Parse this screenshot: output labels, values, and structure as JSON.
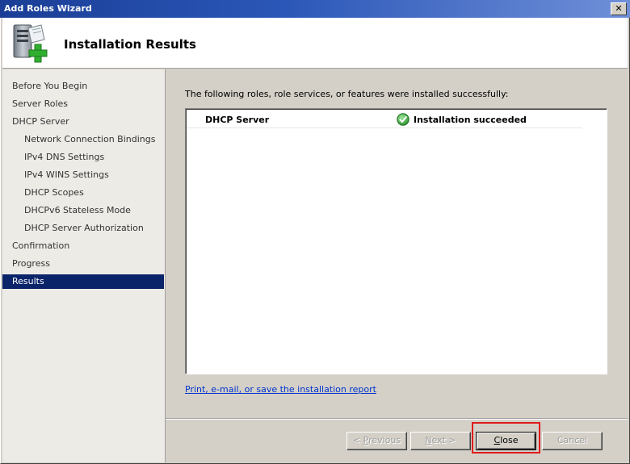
{
  "window": {
    "title": "Add Roles Wizard",
    "close_glyph": "✕"
  },
  "header": {
    "icon": "server-add-role-icon",
    "title": "Installation Results"
  },
  "sidebar": {
    "items": [
      {
        "label": "Before You Begin",
        "indent": false,
        "selected": false
      },
      {
        "label": "Server Roles",
        "indent": false,
        "selected": false
      },
      {
        "label": "DHCP Server",
        "indent": false,
        "selected": false
      },
      {
        "label": "Network Connection Bindings",
        "indent": true,
        "selected": false
      },
      {
        "label": "IPv4 DNS Settings",
        "indent": true,
        "selected": false
      },
      {
        "label": "IPv4 WINS Settings",
        "indent": true,
        "selected": false
      },
      {
        "label": "DHCP Scopes",
        "indent": true,
        "selected": false
      },
      {
        "label": "DHCPv6 Stateless Mode",
        "indent": true,
        "selected": false
      },
      {
        "label": "DHCP Server Authorization",
        "indent": true,
        "selected": false
      },
      {
        "label": "Confirmation",
        "indent": false,
        "selected": false
      },
      {
        "label": "Progress",
        "indent": false,
        "selected": false
      },
      {
        "label": "Results",
        "indent": false,
        "selected": true
      }
    ]
  },
  "main": {
    "intro": "The following roles, role services, or features were installed successfully:",
    "results": [
      {
        "role": "DHCP Server",
        "status": "Installation succeeded",
        "status_icon": "check-circle-icon"
      }
    ],
    "report_link": "Print, e-mail, or save the installation report"
  },
  "buttons": {
    "previous": {
      "label_prefix": "< ",
      "label_accel": "P",
      "label_rest": "revious",
      "enabled": false
    },
    "next": {
      "label_prefix": "",
      "label_accel": "N",
      "label_rest": "ext >",
      "enabled": false
    },
    "close": {
      "label_prefix": "",
      "label_accel": "C",
      "label_rest": "lose",
      "enabled": true
    },
    "cancel": {
      "label": "Cancel",
      "enabled": false
    }
  },
  "colors": {
    "selection": "#0a246a",
    "highlight": "#e11b1b",
    "link": "#0033cc",
    "success": "#3aa43a"
  }
}
